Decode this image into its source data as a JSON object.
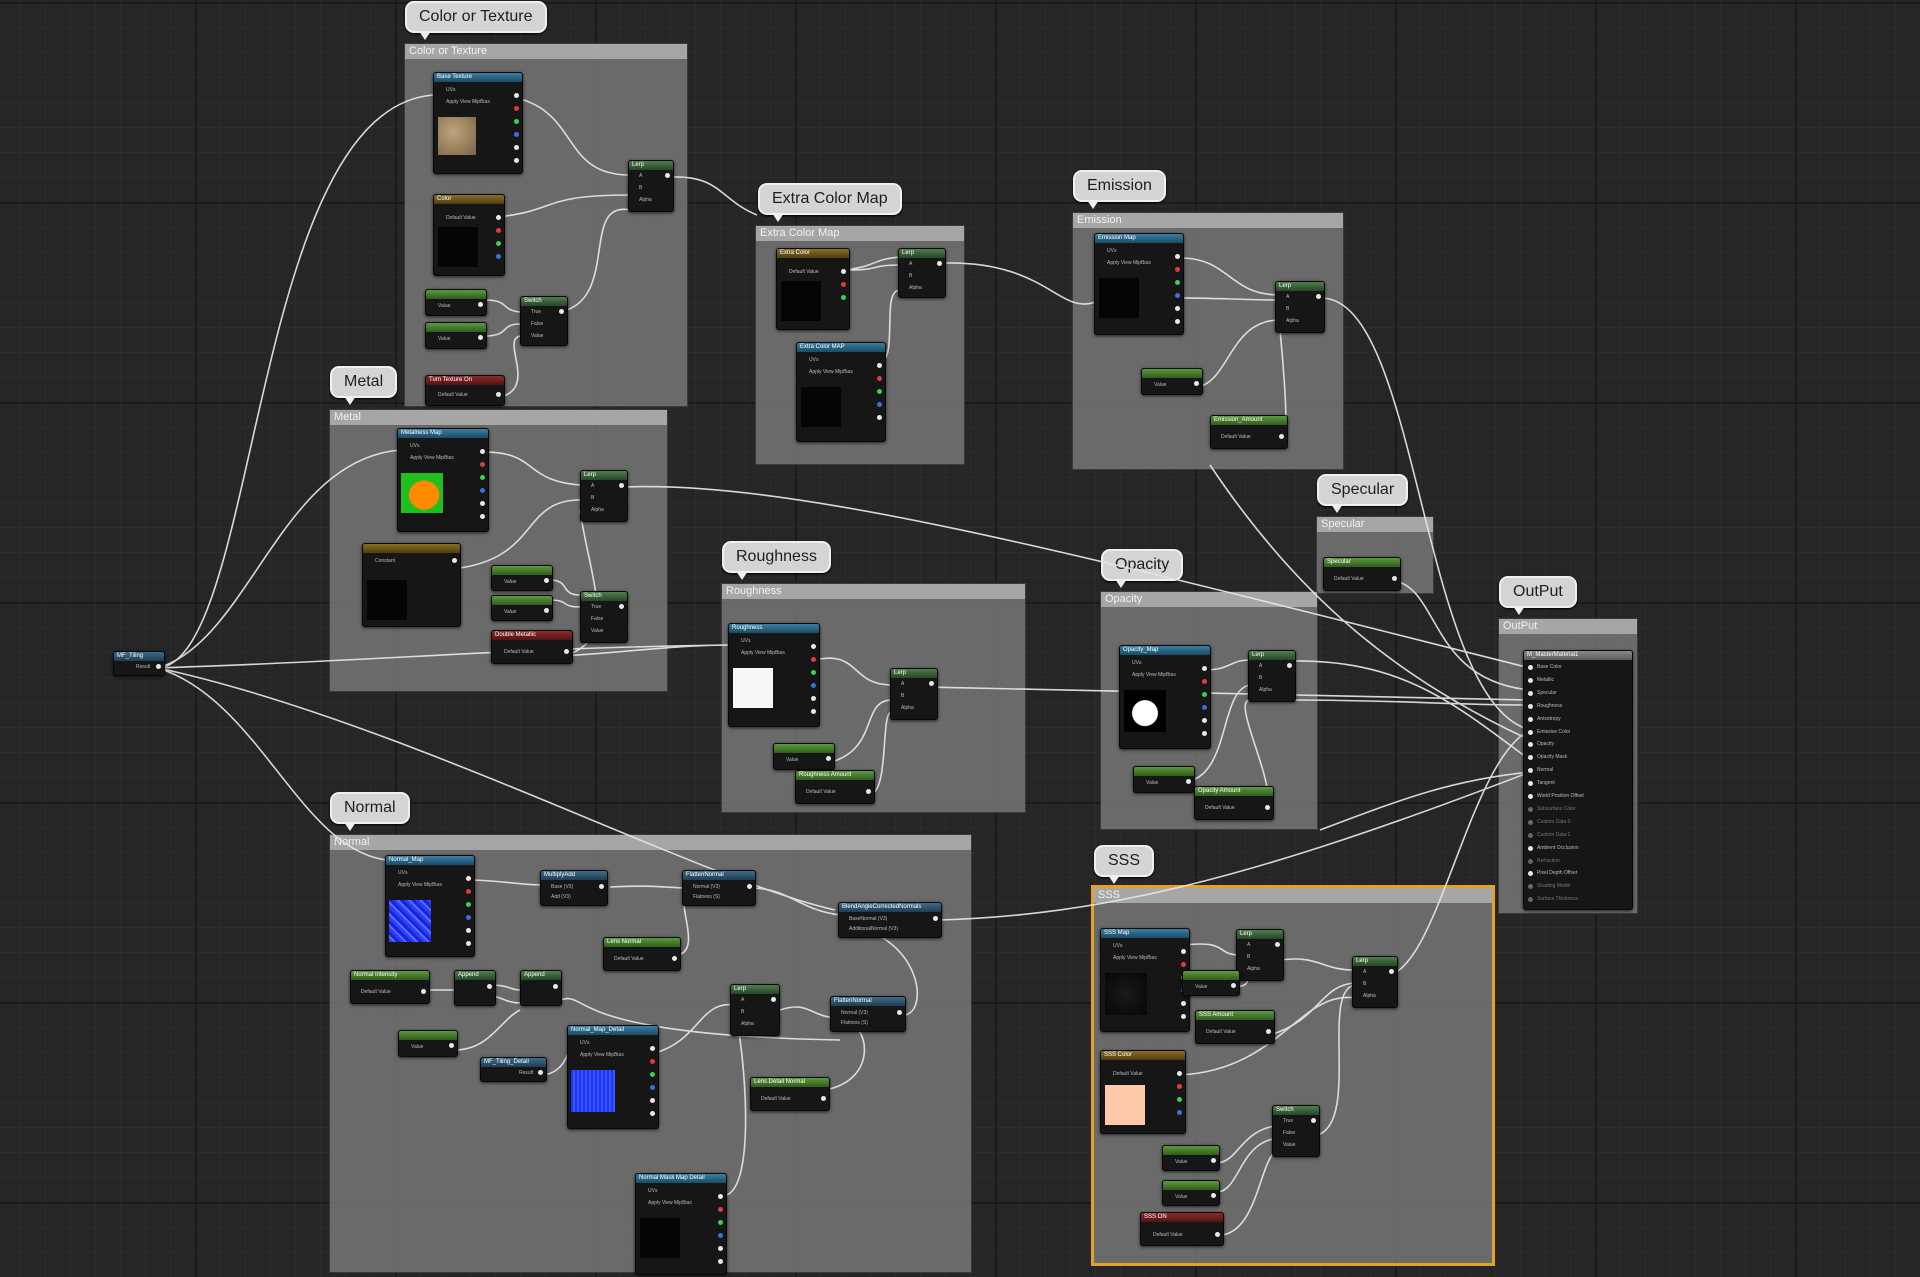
{
  "comments": {
    "color_texture": {
      "label": "Color or Texture",
      "bar": "Color or Texture"
    },
    "metal": {
      "label": "Metal",
      "bar": "Metal"
    },
    "extra_color": {
      "label": "Extra Color Map",
      "bar": "Extra Color Map"
    },
    "emission": {
      "label": "Emission",
      "bar": "Emission"
    },
    "specular": {
      "label": "Specular",
      "bar": "Specular"
    },
    "roughness": {
      "label": "Roughness",
      "bar": "Roughness"
    },
    "opacity": {
      "label": "Opacity",
      "bar": "Opacity"
    },
    "output": {
      "label": "OutPut",
      "bar": "OutPut"
    },
    "normal": {
      "label": "Normal",
      "bar": "Normal"
    },
    "sss": {
      "label": "SSS",
      "bar": "SSS"
    }
  },
  "nodes": {
    "base_texture": {
      "title": "Base Texture",
      "rows": [
        "UVs",
        "Apply View MipBias"
      ]
    },
    "color_param": {
      "title": "Color",
      "rows": [
        "Default Value"
      ]
    },
    "lerp": "Lerp",
    "switch": "Switch",
    "value_label": "Value",
    "default_value_label": "Default Value",
    "turn_texture_on": {
      "title": "Turn Texture On",
      "rows": [
        "Default Value"
      ]
    },
    "metalness_map": {
      "title": "Metalness Map",
      "rows": [
        "UVs",
        "Apply View MipBias"
      ]
    },
    "constant": "Constant",
    "double_metallic": {
      "title": "Double Metallic",
      "rows": [
        "Default Value"
      ]
    },
    "mf_tiling": {
      "title": "MF_Tiling",
      "rows": [
        "Result"
      ]
    },
    "extra_color": {
      "title": "Extra Color",
      "rows": [
        "Default Value"
      ]
    },
    "extra_color_map": {
      "title": "Extra Color MAP",
      "rows": [
        "UVs",
        "Apply View MipBias"
      ]
    },
    "emission_map": {
      "title": "Emission Map",
      "rows": [
        "UVs",
        "Apply View MipBias"
      ]
    },
    "emission_amount": {
      "title": "Emission_Amount",
      "rows": [
        "Default Value"
      ]
    },
    "specular": {
      "title": "Specular",
      "rows": [
        "Default Value"
      ]
    },
    "roughness": {
      "title": "Roughness",
      "rows": [
        "UVs",
        "Apply View MipBias"
      ]
    },
    "roughness_amount": {
      "title": "Roughness Amount",
      "rows": [
        "Default Value"
      ]
    },
    "opacity_map": {
      "title": "Opacity_Map",
      "rows": [
        "UVs",
        "Apply View MipBias"
      ]
    },
    "opacity_amount": {
      "title": "Opacity Amount",
      "rows": [
        "Default Value"
      ]
    },
    "master": {
      "title": "M_MasterMaterial1",
      "pins": [
        "Base Color",
        "Metallic",
        "Specular",
        "Roughness",
        "Anisotropy",
        "Emissive Color",
        "Opacity",
        "Opacity Mask",
        "Normal",
        "Tangent",
        "World Position Offset",
        "Subsurface Color",
        "Custom Data 0",
        "Custom Data 1",
        "Ambient Occlusion",
        "Refraction",
        "Pixel Depth Offset",
        "Shading Model",
        "Surface Thickness"
      ]
    },
    "normal_map": {
      "title": "Normal_Map",
      "rows": [
        "UVs",
        "Apply View MipBias"
      ]
    },
    "multiply_add": {
      "title": "MultiplyAdd",
      "rows": [
        "Base (V3)",
        "Add (V3)"
      ]
    },
    "flatten_normal": {
      "title": "FlattenNormal",
      "rows": [
        "Normal (V3)",
        "Flatness (S)"
      ]
    },
    "blend_angle": {
      "title": "BlendAngleCorrectedNormals",
      "rows": [
        "BaseNormal (V3)",
        "AdditionalNormal (V3)"
      ]
    },
    "lens_normal": {
      "title": "Lens Normal",
      "rows": [
        "Default Value"
      ]
    },
    "normal_intensity": {
      "title": "Normal Intensity",
      "rows": [
        "Default Value"
      ]
    },
    "append": "Append",
    "mf_tiling_detail": {
      "title": "MF_Tiling_Detail",
      "rows": [
        "Result"
      ]
    },
    "normal_map_detail": {
      "title": "Normal_Map_Detail",
      "rows": [
        "UVs",
        "Apply View MipBias"
      ]
    },
    "lens_detail_normal": {
      "title": "Lens Detail Normal",
      "rows": [
        "Default Value"
      ]
    },
    "normal_mask_detail": {
      "title": "Normal Mask Map Detail",
      "rows": [
        "UVs",
        "Apply View MipBias"
      ]
    },
    "sss_map": {
      "title": "SSS Map",
      "rows": [
        "UVs",
        "Apply View MipBias"
      ]
    },
    "sss_amount": {
      "title": "SSS Amount",
      "rows": [
        "Default Value"
      ]
    },
    "sss_color": {
      "title": "SSS Color",
      "rows": [
        "Default Value"
      ]
    },
    "sss_on": {
      "title": "SSS ON",
      "rows": [
        "Default Value"
      ]
    },
    "result": "Result",
    "switch_rows": [
      "True",
      "False",
      "Value"
    ],
    "lerp_rows": [
      "A",
      "B",
      "Alpha"
    ]
  },
  "colors": {
    "accent_selection": "#e3a12a",
    "graph_bg": "#262626",
    "comment_body": "#767676",
    "albedo_preview": "#ffc8a8"
  }
}
